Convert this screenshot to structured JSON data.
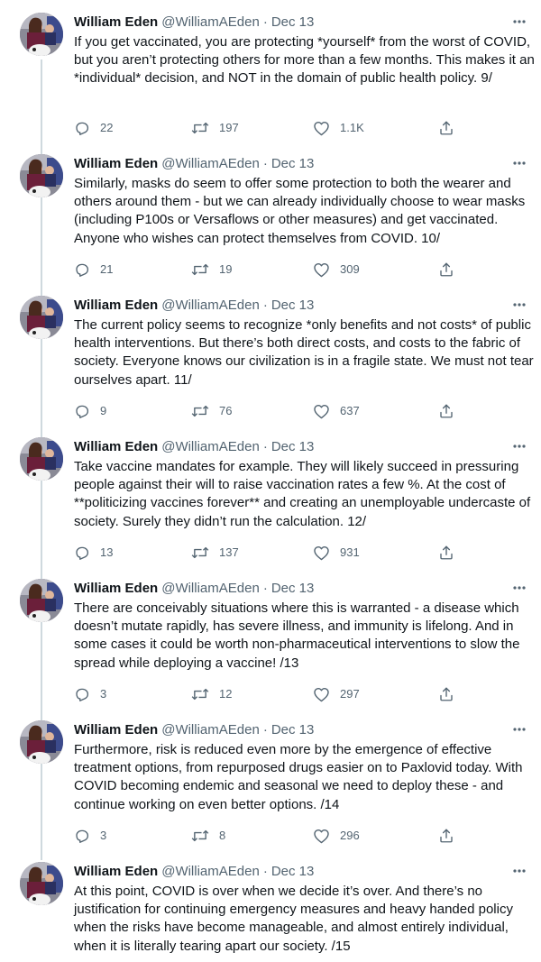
{
  "author": {
    "name": "William Eden",
    "handle": "@WilliamAEden",
    "separator": "·",
    "date": "Dec 13"
  },
  "tweets": [
    {
      "text": "If you get vaccinated, you are protecting *yourself* from the worst of COVID, but you aren’t protecting others for more than a few months. This makes it an *individual* decision, and NOT in the domain of public health policy. 9/",
      "replies": "22",
      "retweets": "197",
      "likes": "1.1K"
    },
    {
      "text": "Similarly, masks do seem to offer some protection to both the wearer and others around them - but we can already individually choose to wear masks (including P100s or Versaflows or other measures) and get vaccinated. Anyone who wishes can protect themselves from COVID. 10/",
      "replies": "21",
      "retweets": "19",
      "likes": "309"
    },
    {
      "text": "The current policy seems to recognize *only benefits and not costs* of public health interventions. But there’s both direct costs, and costs to the fabric of society. Everyone knows our civilization is in a fragile state. We must not tear ourselves apart. 11/",
      "replies": "9",
      "retweets": "76",
      "likes": "637"
    },
    {
      "text": "Take vaccine mandates for example. They will likely succeed in pressuring people against their will to raise vaccination rates a few %. At the cost of **politicizing vaccines forever** and creating an unemployable undercaste of society. Surely they didn’t run the calculation. 12/",
      "replies": "13",
      "retweets": "137",
      "likes": "931"
    },
    {
      "text": "There are conceivably situations where this is warranted - a disease which doesn’t mutate rapidly, has severe illness, and immunity is lifelong. And in some cases it could be worth non-pharmaceutical interventions to slow the spread while deploying a vaccine! /13",
      "replies": "3",
      "retweets": "12",
      "likes": "297"
    },
    {
      "text": "Furthermore, risk is reduced even more by the emergence of effective treatment options, from repurposed drugs easier on to Paxlovid today. With COVID becoming endemic and seasonal we need to deploy these - and continue working on even better options. /14",
      "replies": "3",
      "retweets": "8",
      "likes": "296"
    },
    {
      "text": "At this point, COVID is over when we decide it’s over. And there’s no justification for continuing emergency measures and heavy handed policy when the risks have become manageable, and almost entirely individual, when it is literally tearing apart our society. /15",
      "replies": "",
      "retweets": "",
      "likes": ""
    }
  ],
  "icons": {
    "more": "more-horizontal-icon",
    "reply": "reply-icon",
    "retweet": "retweet-icon",
    "like": "heart-icon",
    "share": "share-icon"
  },
  "colors": {
    "text": "#0f1419",
    "secondary": "#536471",
    "thread_line": "#cfd9de"
  }
}
